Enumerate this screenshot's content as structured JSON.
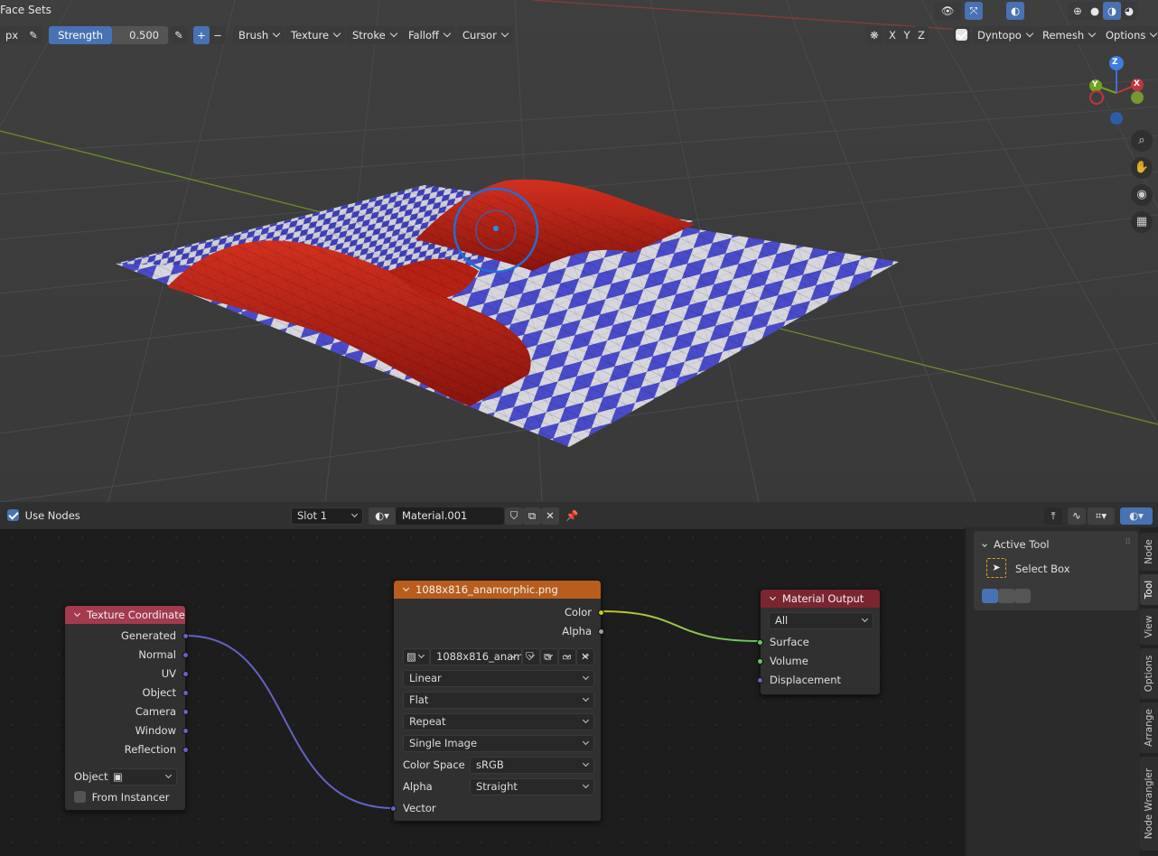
{
  "viewport": {
    "mode_label": "Face Sets",
    "toolbar": {
      "unit": "px",
      "strength_label": "Strength",
      "strength_value": "0.500",
      "plus": "+",
      "minus": "−",
      "menus": [
        "Brush",
        "Texture",
        "Stroke",
        "Falloff",
        "Cursor"
      ],
      "axes": [
        "X",
        "Y",
        "Z"
      ],
      "dyntopo": "Dyntopo",
      "remesh": "Remesh",
      "options": "Options"
    },
    "gizmo": {
      "z": "Z",
      "y": "Y",
      "x": "X"
    },
    "colors": {
      "background": "#3d3d3d",
      "red_mesh": "#c8231a",
      "checker_blue": "#4a4bc9",
      "checker_white": "#d8d8d8",
      "brush_circle": "#1f6fd6"
    }
  },
  "node_editor": {
    "use_nodes_label": "Use Nodes",
    "slot": "Slot 1",
    "material_name": "Material.001",
    "nodes": {
      "texture_coordinate": {
        "title": "Texture Coordinate",
        "outputs": [
          "Generated",
          "Normal",
          "UV",
          "Object",
          "Camera",
          "Window",
          "Reflection"
        ],
        "object_label": "Object:",
        "from_instancer": "From Instancer",
        "color": "#a33a4e"
      },
      "image_texture": {
        "title": "1088x816_anamorphic.png",
        "outputs": [
          "Color",
          "Alpha"
        ],
        "image_name": "1088x816_anam...",
        "interpolation": "Linear",
        "projection": "Flat",
        "extension": "Repeat",
        "source": "Single Image",
        "color_space_label": "Color Space",
        "color_space": "sRGB",
        "alpha_label": "Alpha",
        "alpha_mode": "Straight",
        "input": "Vector",
        "color": "#b85d1d"
      },
      "material_output": {
        "title": "Material Output",
        "target": "All",
        "inputs": [
          "Surface",
          "Volume",
          "Displacement"
        ],
        "color": "#7a2530"
      }
    },
    "sidebar": {
      "panel_title": "Active Tool",
      "tool_name": "Select Box",
      "tabs": [
        "Node",
        "Tool",
        "View",
        "Options",
        "Arrange",
        "Node Wrangler"
      ],
      "active_tab": "Tool"
    }
  }
}
